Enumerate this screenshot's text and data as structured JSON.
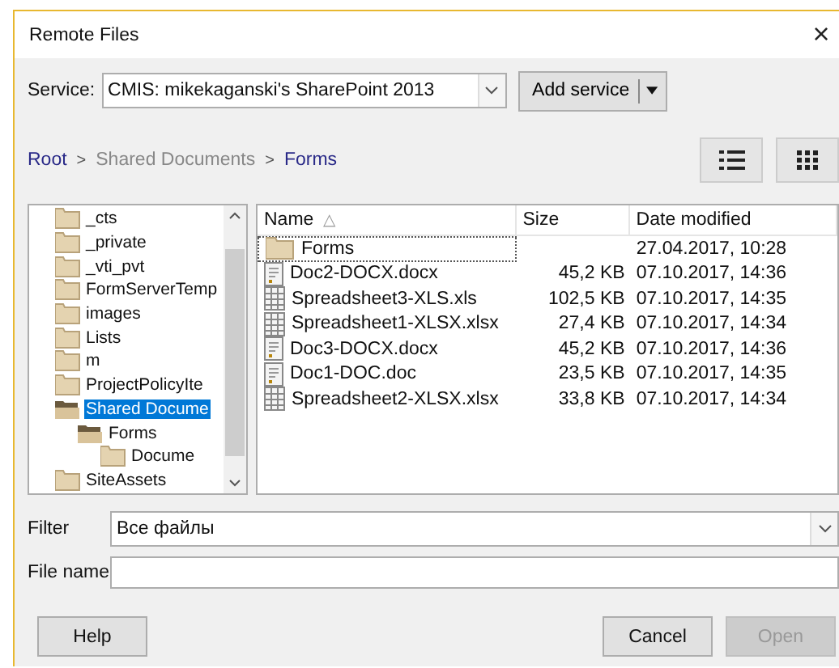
{
  "window": {
    "title": "Remote Files",
    "close": "×"
  },
  "service": {
    "label": "Service:",
    "value": "CMIS: mikekaganski's SharePoint 2013",
    "add_button": "Add service"
  },
  "breadcrumb": [
    {
      "label": "Root",
      "link": true
    },
    {
      "separator": ">",
      "label": "Shared Documents",
      "link": false
    },
    {
      "separator": ">",
      "label": "Forms",
      "link": true
    }
  ],
  "view_buttons": [
    {
      "kind": "list"
    },
    {
      "kind": "grid"
    }
  ],
  "tree": [
    {
      "label": "_cts",
      "selected": false,
      "expanded": false
    },
    {
      "label": "_private",
      "selected": false,
      "expanded": false
    },
    {
      "label": "_vti_pvt",
      "selected": false,
      "expanded": false
    },
    {
      "label": "FormServerTemp",
      "selected": false,
      "expanded": false
    },
    {
      "label": "images",
      "selected": false,
      "expanded": false
    },
    {
      "label": "Lists",
      "selected": false,
      "expanded": false
    },
    {
      "label": "m",
      "selected": false,
      "expanded": false
    },
    {
      "label": "ProjectPolicyIte",
      "selected": false,
      "expanded": false
    },
    {
      "label": "Shared Docume",
      "selected": true,
      "expanded": true,
      "children": [
        {
          "label": "Forms",
          "selected": false,
          "expanded": true,
          "children": [
            {
              "label": "Docume",
              "selected": false,
              "expanded": false
            }
          ]
        }
      ]
    },
    {
      "label": "SiteAssets",
      "selected": false,
      "expanded": false
    }
  ],
  "table": {
    "columns": [
      {
        "label": "Name",
        "sort": "△"
      },
      {
        "label": "Size"
      },
      {
        "label": "Date modified"
      }
    ],
    "rows": [
      {
        "kind": "folder",
        "name": "Forms",
        "size": "",
        "date": "27.04.2017, 10:28",
        "focused": true
      },
      {
        "kind": "doc",
        "name": "Doc2-DOCX.docx",
        "size": "45,2 KB",
        "date": "07.10.2017, 14:36",
        "focused": false
      },
      {
        "kind": "sheet",
        "name": "Spreadsheet3-XLS.xls",
        "size": "102,5 KB",
        "date": "07.10.2017, 14:35",
        "focused": false
      },
      {
        "kind": "sheet",
        "name": "Spreadsheet1-XLSX.xlsx",
        "size": "27,4 KB",
        "date": "07.10.2017, 14:34",
        "focused": false
      },
      {
        "kind": "doc",
        "name": "Doc3-DOCX.docx",
        "size": "45,2 KB",
        "date": "07.10.2017, 14:36",
        "focused": false
      },
      {
        "kind": "doc",
        "name": "Doc1-DOC.doc",
        "size": "23,5 KB",
        "date": "07.10.2017, 14:35",
        "focused": false
      },
      {
        "kind": "sheet",
        "name": "Spreadsheet2-XLSX.xlsx",
        "size": "33,8 KB",
        "date": "07.10.2017, 14:34",
        "focused": false
      }
    ]
  },
  "filter": {
    "label": "Filter",
    "value": "Все файлы"
  },
  "file_name": {
    "label": "File name"
  },
  "buttons": [
    {
      "label": "Help",
      "disabled": false
    },
    {
      "label": "Cancel",
      "disabled": false
    },
    {
      "label": "Open",
      "disabled": true
    }
  ]
}
